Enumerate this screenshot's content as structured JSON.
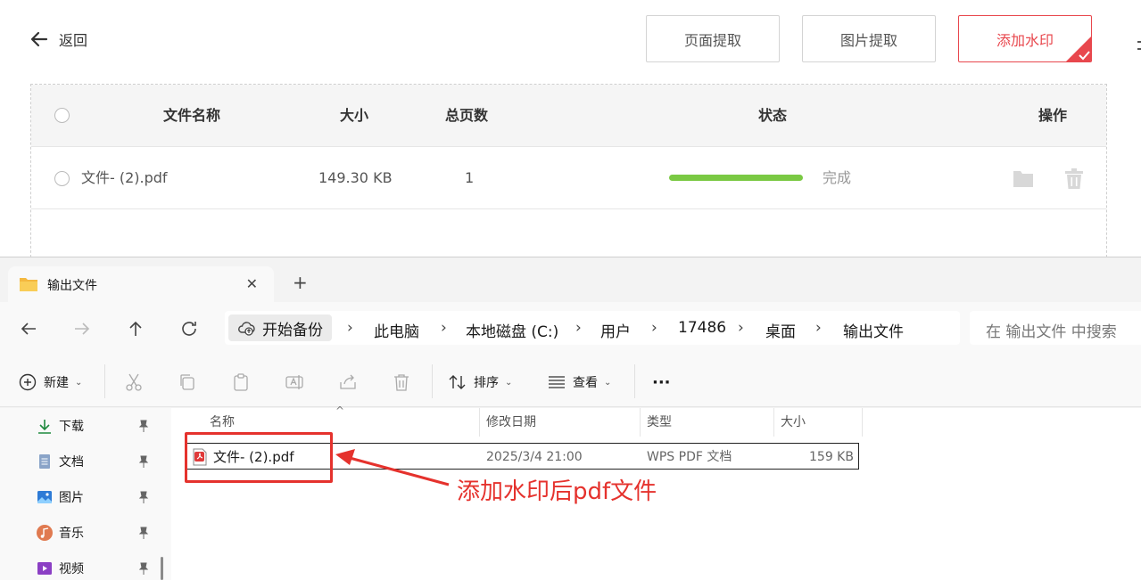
{
  "app": {
    "back_label": "返回",
    "buttons": [
      "页面提取",
      "图片提取",
      "添加水印"
    ],
    "accent_color": "#e8474d",
    "columns": {
      "name": "文件名称",
      "size": "大小",
      "pages": "总页数",
      "status": "状态",
      "actions": "操作"
    },
    "rows": [
      {
        "name": "文件- (2).pdf",
        "size": "149.30 KB",
        "pages": "1",
        "progress": 1.0,
        "status": "完成"
      }
    ],
    "progress_color": "#7ac943"
  },
  "explorer": {
    "tab_title": "输出文件",
    "breadcrumb": [
      "开始备份",
      "此电脑",
      "本地磁盘 (C:)",
      "用户",
      "17486",
      "桌面",
      "输出文件"
    ],
    "search_placeholder": "在 输出文件 中搜索",
    "commands": {
      "new": "新建",
      "sort": "排序",
      "view": "查看",
      "more": "···"
    },
    "sidebar": [
      {
        "label": "下载",
        "icon": "download-icon"
      },
      {
        "label": "文档",
        "icon": "document-icon"
      },
      {
        "label": "图片",
        "icon": "pictures-icon"
      },
      {
        "label": "音乐",
        "icon": "music-icon"
      },
      {
        "label": "视频",
        "icon": "video-icon"
      }
    ],
    "columns": {
      "name": "名称",
      "modified": "修改日期",
      "type": "类型",
      "size": "大小"
    },
    "files": [
      {
        "name": "文件- (2).pdf",
        "modified": "2025/3/4 21:00",
        "type": "WPS PDF 文档",
        "size": "159 KB"
      }
    ]
  },
  "annotation": {
    "text": "添加水印后pdf文件",
    "color": "#e5322d"
  }
}
